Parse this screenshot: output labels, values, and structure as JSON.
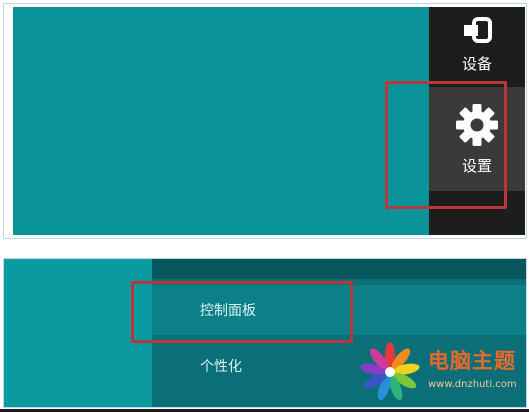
{
  "top_panel": {
    "charms": {
      "devices_label": "设备",
      "settings_label": "设置"
    }
  },
  "bottom_panel": {
    "menu": {
      "items": [
        {
          "label": "控制面板"
        },
        {
          "label": "个性化"
        }
      ]
    }
  },
  "watermark": {
    "title": "电脑主题",
    "url": "www.dnzhuti.com"
  },
  "colors": {
    "desktop": "#0a949a",
    "charms_bar": "#1d1d1d",
    "highlight": "#b8373a",
    "menu_bg": "#0b6f77"
  }
}
